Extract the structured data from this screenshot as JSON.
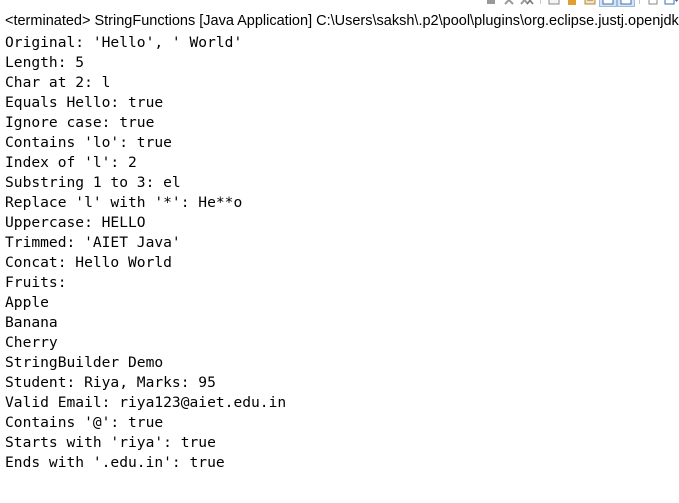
{
  "console": {
    "header": "<terminated> StringFunctions [Java Application] C:\\Users\\saksh\\.p2\\pool\\plugins\\org.eclipse.justj.openjdk",
    "lines": [
      "Original: 'Hello', ' World'",
      "Length: 5",
      "Char at 2: l",
      "Equals Hello: true",
      "Ignore case: true",
      "Contains 'lo': true",
      "Index of 'l': 2",
      "Substring 1 to 3: el",
      "Replace 'l' with '*': He**o",
      "Uppercase: HELLO",
      "Trimmed: 'AIET Java'",
      "Concat: Hello World",
      "Fruits:",
      "Apple",
      "Banana",
      "Cherry",
      "StringBuilder Demo",
      "Student: Riya, Marks: 95",
      "Valid Email: riya123@aiet.edu.in",
      "Contains '@': true",
      "Starts with 'riya': true",
      "Ends with '.edu.in': true"
    ]
  },
  "toolbar": {
    "icons": [
      "terminate-icon",
      "remove-launch-icon",
      "remove-all-terminated-icon",
      "clear-console-icon",
      "scroll-lock-icon",
      "word-wrap-icon",
      "show-console-on-stdout-icon",
      "show-console-on-stderr-icon",
      "pin-console-icon",
      "display-selected-console-icon"
    ],
    "colors": {
      "red": "#c0392b",
      "gray": "#9a9a9a",
      "amber": "#e0a030",
      "blue": "#3a73b8",
      "selected_bg": "#d6e4f3"
    }
  }
}
